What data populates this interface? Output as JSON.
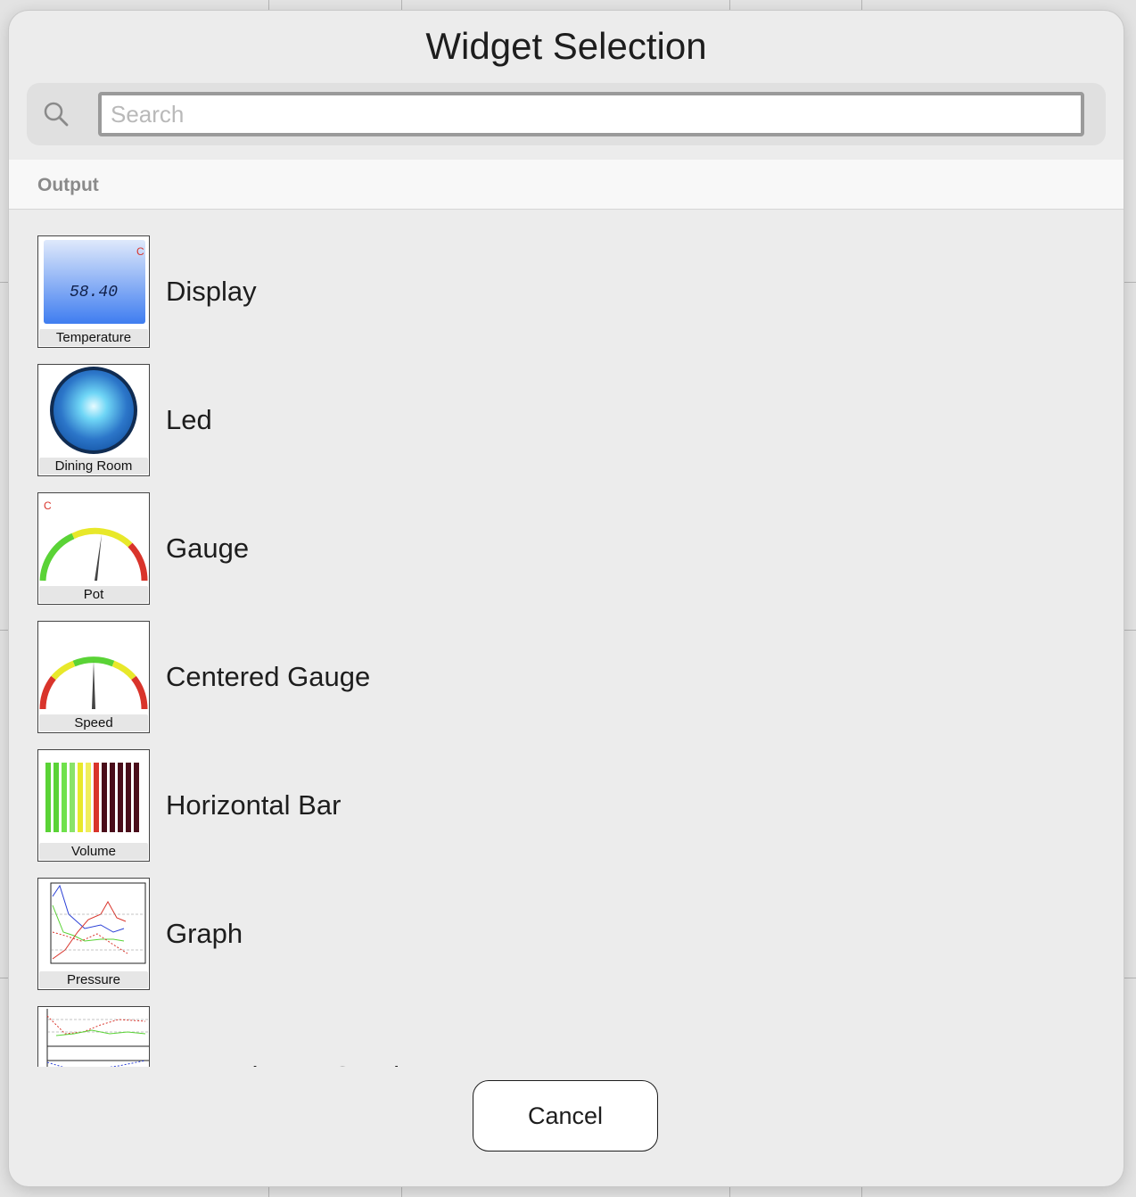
{
  "dialog": {
    "title": "Widget Selection"
  },
  "search": {
    "placeholder": "Search",
    "value": ""
  },
  "section": {
    "header": "Output"
  },
  "widgets": [
    {
      "label": "Display",
      "caption": "Temperature",
      "icon": "display-widget-preview",
      "reading": "58.40",
      "unit": "C"
    },
    {
      "label": "Led",
      "caption": "Dining Room",
      "icon": "led-widget-preview"
    },
    {
      "label": "Gauge",
      "caption": "Pot",
      "icon": "gauge-widget-preview",
      "unit": "C"
    },
    {
      "label": "Centered Gauge",
      "caption": "Speed",
      "icon": "centered-gauge-widget-preview"
    },
    {
      "label": "Horizontal Bar",
      "caption": "Volume",
      "icon": "horizontal-bar-widget-preview"
    },
    {
      "label": "Graph",
      "caption": "Pressure",
      "icon": "graph-widget-preview"
    },
    {
      "label": "Logged Data Graph",
      "caption": "",
      "icon": "logged-data-graph-widget-preview"
    }
  ],
  "actions": {
    "cancel_label": "Cancel"
  },
  "colors": {
    "led_blue": "#1c5fb0",
    "gauge_green": "#5ad336",
    "gauge_yellow": "#e8e82a",
    "gauge_red": "#d9342b",
    "display_blue": "#3f7df0"
  }
}
